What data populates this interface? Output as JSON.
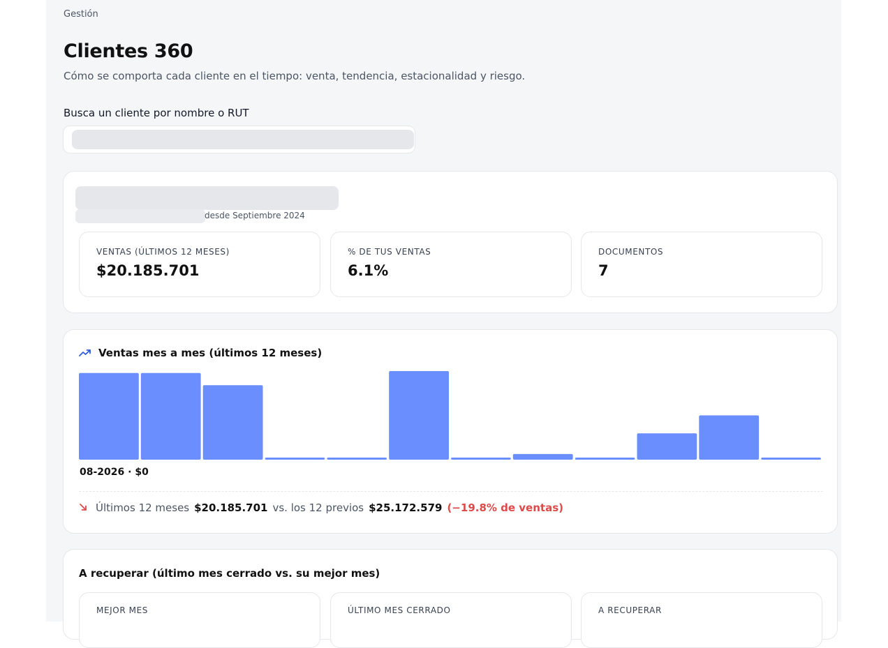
{
  "breadcrumb": "Gestión",
  "page": {
    "title": "Clientes 360",
    "subtitle": "Cómo se comporta cada cliente en el tiempo: venta, tendencia, estacionalidad y riesgo."
  },
  "search": {
    "label": "Busca un cliente por nombre o RUT",
    "value": ""
  },
  "client": {
    "since": "desde Septiembre 2024",
    "kpis": [
      {
        "label": "VENTAS (ÚLTIMOS 12 MESES)",
        "value": "$20.185.701"
      },
      {
        "label": "% DE TUS VENTAS",
        "value": "6.1%"
      },
      {
        "label": "DOCUMENTOS",
        "value": "7"
      }
    ]
  },
  "sales_chart": {
    "title": "Ventas mes a mes (últimos 12 meses)",
    "icon": "trending-up-icon",
    "caption": "08-2026 · $0",
    "comparison": {
      "label_last": "Últimos 12 meses",
      "value_last": "$20.185.701",
      "label_prev": "vs. los 12 previos",
      "value_prev": "$25.172.579",
      "delta": "(−19.8% de ventas)",
      "icon": "trend-down-arrow-icon"
    }
  },
  "chart_data": {
    "type": "bar",
    "values": [
      4600000,
      4600000,
      3950000,
      50000,
      50000,
      4700000,
      50000,
      300000,
      50000,
      1400000,
      2350000,
      50000
    ],
    "ylim": [
      0,
      4700000
    ],
    "grid": false,
    "colors": {
      "bar": "#6a8efd"
    }
  },
  "recover": {
    "title": "A recuperar (último mes cerrado vs. su mejor mes)",
    "kpis": [
      {
        "label": "MEJOR MES"
      },
      {
        "label": "ÚLTIMO MES CERRADO"
      },
      {
        "label": "A RECUPERAR"
      }
    ]
  },
  "colors": {
    "accent": "#6a8efd",
    "negative": "#dc4a4a",
    "trend_icon": "#2f5bd8"
  }
}
